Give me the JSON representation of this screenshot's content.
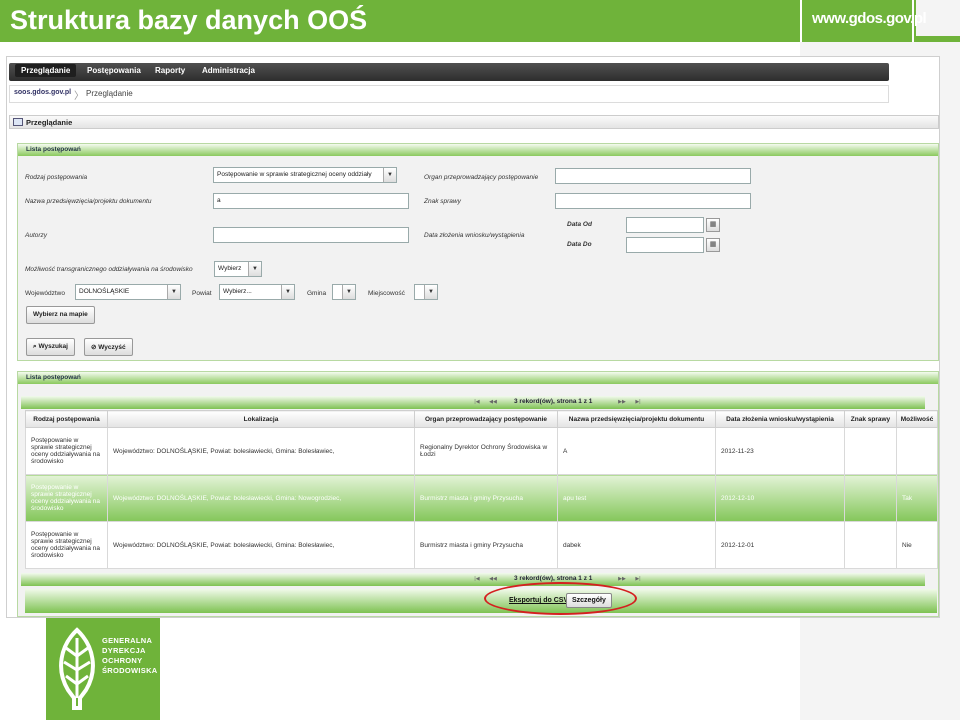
{
  "slide": {
    "title": "Struktura bazy danych OOŚ",
    "brand": "www.gdos.gov.pl"
  },
  "nav": {
    "items": [
      "Przeglądanie",
      "Postępowania",
      "Raporty",
      "Administracja"
    ]
  },
  "breadcrumb": {
    "site": "soos.gdos.gov.pl",
    "separator": "〉",
    "page": "Przeglądanie"
  },
  "panel": {
    "title": "Przeglądanie"
  },
  "filters": {
    "legend": "Lista postępowań",
    "rodzaj_label": "Rodzaj postępowania",
    "rodzaj_value": "Postępowanie w sprawie strategicznej oceny oddziały",
    "organ_label": "Organ przeprowadzający postępowanie",
    "organ_value": "",
    "nazwa_label": "Nazwa przedsięwzięcia/projektu dokumentu",
    "nazwa_value": "a",
    "znak_label": "Znak sprawy",
    "znak_value": "",
    "autorzy_label": "Autorzy",
    "autorzy_value": "",
    "data_zlozenia_label": "Data złożenia wniosku/wystąpienia",
    "data_od_label": "Data Od",
    "data_od_value": "",
    "data_do_label": "Data Do",
    "data_do_value": "",
    "transgraniczne_label": "Możliwość transgranicznego oddziaływania na środowisko",
    "transgraniczne_value": "Wybierz",
    "woj_label": "Województwo",
    "woj_value": "DOLNOŚLĄSKIE",
    "powiat_label": "Powiat",
    "powiat_value": "Wybierz...",
    "gmina_label": "Gmina",
    "gmina_value": "",
    "miejscowosc_label": "Miejscowość",
    "miejscowosc_value": "",
    "map_button": "Wybierz na mapie",
    "search_button": "Wyszukaj",
    "clear_button": "Wyczyść"
  },
  "results": {
    "legend": "Lista postępowań",
    "pager_text": "3 rekord(ów), strona 1 z 1",
    "columns": [
      "Rodzaj postępowania",
      "Lokalizacja",
      "Organ przeprowadzający postępowanie",
      "Nazwa przedsięwzięcia/projektu dokumentu",
      "Data złożenia wniosku/wystąpienia",
      "Znak sprawy",
      "Możliwość"
    ],
    "rows": [
      {
        "rodzaj": "Postępowanie w sprawie strategicznej oceny oddziaływania na środowisko",
        "lokalizacja": "Województwo: DOLNOŚLĄSKIE, Powiat: bolesławiecki, Gmina: Bolesławiec,",
        "organ": "Regionalny Dyrektor Ochrony Środowiska w Łodzi",
        "nazwa": "A",
        "data": "2012-11-23",
        "znak": "",
        "mozliwosc": ""
      },
      {
        "rodzaj": "Postępowanie w sprawie strategicznej oceny oddziaływania na środowisko",
        "lokalizacja": "Województwo: DOLNOŚLĄSKIE, Powiat: bolesławiecki, Gmina: Nowogrodziec,",
        "organ": "Burmistrz miasta i gminy Przysucha",
        "nazwa": "apu test",
        "data": "2012-12-10",
        "znak": "",
        "mozliwosc": "Tak"
      },
      {
        "rodzaj": "Postępowanie w sprawie strategicznej oceny oddziaływania na środowisko",
        "lokalizacja": "Województwo: DOLNOŚLĄSKIE, Powiat: bolesławiecki, Gmina: Bolesławiec,",
        "organ": "Burmistrz miasta i gminy Przysucha",
        "nazwa": "dabek",
        "data": "2012-12-01",
        "znak": "",
        "mozliwosc": "Nie"
      }
    ],
    "export_link": "Eksportuj do CSV",
    "details_button": "Szczegóły"
  },
  "logo": {
    "lines": [
      "GENERALNA",
      "DYREKCJA",
      "OCHRONY",
      "ŚRODOWISKA"
    ]
  },
  "colors": {
    "accent": "#6fb33a",
    "highlight": "#d42020"
  }
}
